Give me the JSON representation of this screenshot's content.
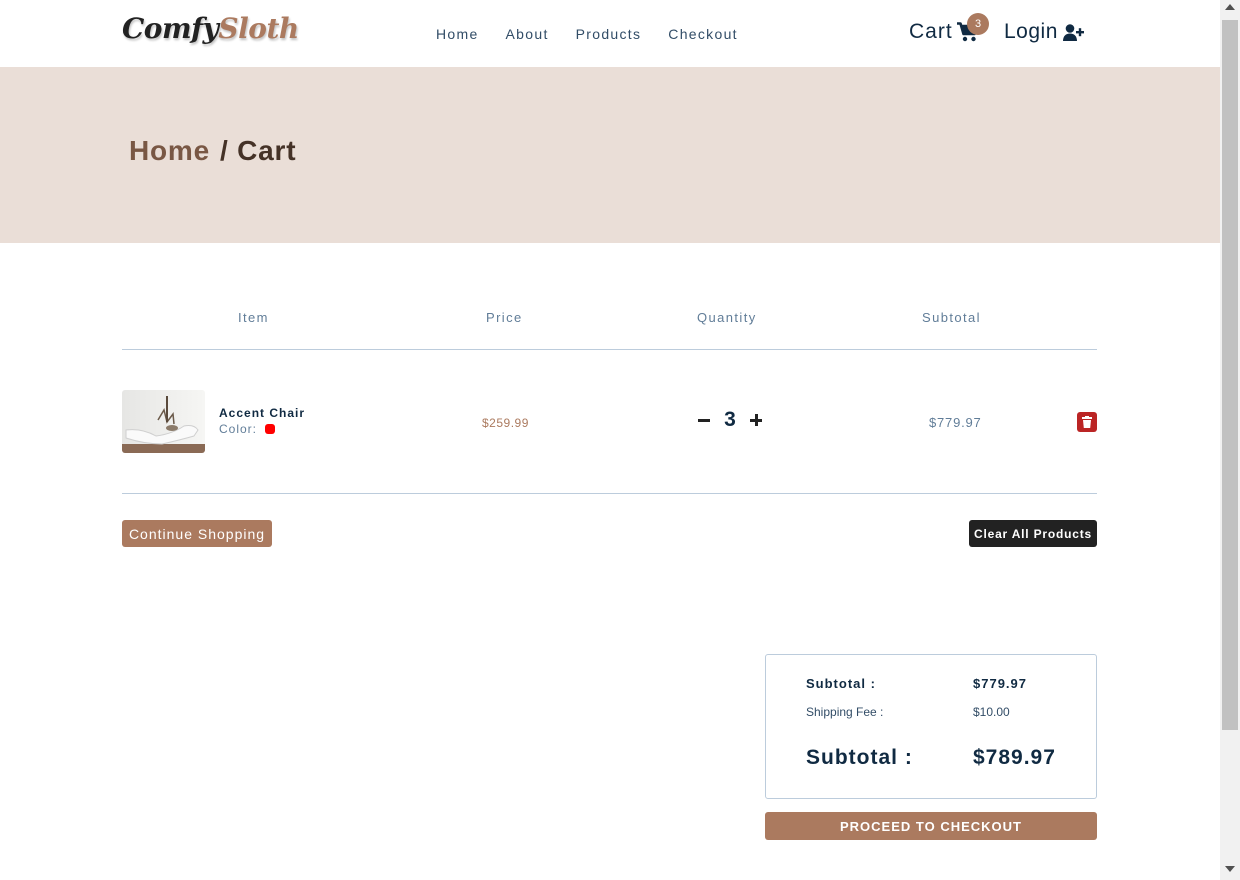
{
  "nav": {
    "logo_part1": "Comfy",
    "logo_part2": "Sloth",
    "links": [
      "Home",
      "About",
      "Products",
      "Checkout"
    ],
    "cart_label": "Cart",
    "cart_count": "3",
    "login_label": "Login"
  },
  "hero": {
    "crumb_home": "Home",
    "crumb_current": "/ Cart"
  },
  "table": {
    "headers": [
      "Item",
      "Price",
      "Quantity",
      "Subtotal"
    ]
  },
  "cart_items": [
    {
      "name": "Accent Chair",
      "color_label": "Color:",
      "color": "#ff0000",
      "price": "$259.99",
      "quantity": "3",
      "subtotal": "$779.97"
    }
  ],
  "actions": {
    "continue_label": "Continue Shopping",
    "clear_label": "Clear All Products"
  },
  "totals": {
    "subtotal_label": "Subtotal :",
    "subtotal_value": "$779.97",
    "shipping_label": "Shipping Fee :",
    "shipping_value": "$10.00",
    "order_total_label": "Subtotal :",
    "order_total_value": "$789.97",
    "checkout_label": "PROCEED TO CHECKOUT"
  },
  "colors": {
    "brand": "#ab7a5f",
    "hero_bg": "#eaded7",
    "danger": "#bb2525"
  }
}
